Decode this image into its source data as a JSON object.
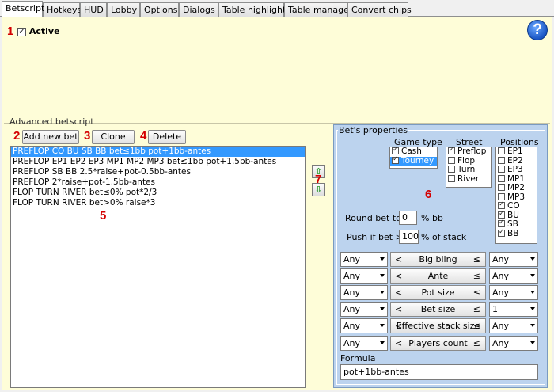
{
  "tabs": [
    "Betscript",
    "Hotkeys",
    "HUD",
    "Lobby",
    "Options",
    "Dialogs",
    "Table highlight",
    "Table manager",
    "Convert chips"
  ],
  "markers": [
    "1",
    "2",
    "3",
    "4",
    "5",
    "6",
    "7"
  ],
  "active_label": "Active",
  "help_glyph": "?",
  "advanced_title": "Advanced betscript",
  "buttons": {
    "add": "Add new bet",
    "clone": "Clone bet",
    "delete": "Delete"
  },
  "bets": [
    "PREFLOP CO BU SB BB bet≤1bb pot+1bb-antes",
    "PREFLOP EP1 EP2 EP3 MP1 MP2 MP3 bet≤1bb pot+1.5bb-antes",
    "PREFLOP SB BB 2.5*raise+pot-0.5bb-antes",
    "PREFLOP 2*raise+pot-1.5bb-antes",
    "FLOP TURN RIVER bet≤0% pot*2/3",
    "FLOP TURN RIVER bet>0% raise*3"
  ],
  "selected_bet_index": 0,
  "arrows": {
    "up": "⇧",
    "down": "⇩"
  },
  "props": {
    "title": "Bet's properties",
    "game_type_title": "Game type",
    "street_title": "Street",
    "positions_title": "Positions",
    "game_types": [
      {
        "label": "Cash",
        "checked": true,
        "selected": false
      },
      {
        "label": "Tourney",
        "checked": true,
        "selected": true
      }
    ],
    "streets": [
      {
        "label": "Preflop",
        "checked": true
      },
      {
        "label": "Flop",
        "checked": false
      },
      {
        "label": "Turn",
        "checked": false
      },
      {
        "label": "River",
        "checked": false
      }
    ],
    "positions": [
      {
        "label": "EP1",
        "checked": false
      },
      {
        "label": "EP2",
        "checked": false
      },
      {
        "label": "EP3",
        "checked": false
      },
      {
        "label": "MP1",
        "checked": false
      },
      {
        "label": "MP2",
        "checked": false
      },
      {
        "label": "MP3",
        "checked": false
      },
      {
        "label": "CO",
        "checked": true
      },
      {
        "label": "BU",
        "checked": true
      },
      {
        "label": "SB",
        "checked": true
      },
      {
        "label": "BB",
        "checked": true
      }
    ],
    "round_label": "Round bet to",
    "round_value": "0",
    "round_unit": "% bb",
    "push_label": "Push if bet >",
    "push_value": "100",
    "push_unit": "% of stack",
    "ranges": [
      {
        "name": "Big bling",
        "min": "Any",
        "max": "Any"
      },
      {
        "name": "Ante",
        "min": "Any",
        "max": "Any"
      },
      {
        "name": "Pot size",
        "min": "Any",
        "max": "Any"
      },
      {
        "name": "Bet size",
        "min": "Any",
        "max": "1"
      },
      {
        "name": "Effective stack size",
        "min": "Any",
        "max": "Any"
      },
      {
        "name": "Players count",
        "min": "Any",
        "max": "Any"
      }
    ],
    "lt": "<",
    "le": "≤",
    "formula_label": "Formula",
    "formula_value": "pot+1bb-antes"
  }
}
